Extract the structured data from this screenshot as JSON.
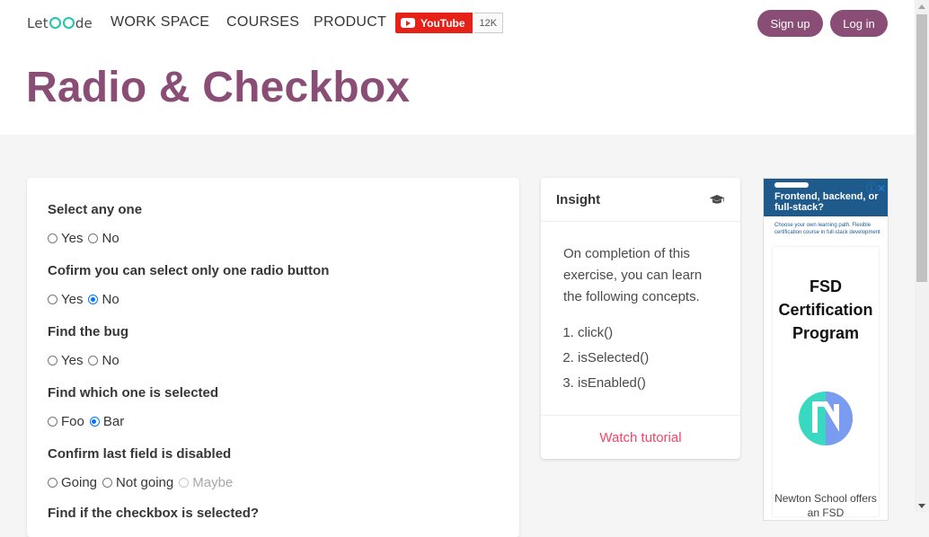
{
  "header": {
    "logo_text_prefix": "Let",
    "logo_text_suffix": "de",
    "nav": [
      "WORK SPACE",
      "COURSES",
      "PRODUCT"
    ],
    "youtube_label": "YouTube",
    "youtube_count": "12K",
    "signup_label": "Sign up",
    "login_label": "Log in"
  },
  "page_title": "Radio & Checkbox",
  "questions": [
    {
      "label": "Select any one",
      "options": [
        {
          "text": "Yes",
          "state": "unchecked"
        },
        {
          "text": "No",
          "state": "unchecked"
        }
      ]
    },
    {
      "label": "Cofirm you can select only one radio button",
      "options": [
        {
          "text": "Yes",
          "state": "unchecked"
        },
        {
          "text": "No",
          "state": "checked"
        }
      ]
    },
    {
      "label": "Find the bug",
      "options": [
        {
          "text": "Yes",
          "state": "unchecked"
        },
        {
          "text": "No",
          "state": "unchecked"
        }
      ]
    },
    {
      "label": "Find which one is selected",
      "options": [
        {
          "text": "Foo",
          "state": "unchecked"
        },
        {
          "text": "Bar",
          "state": "checked"
        }
      ]
    },
    {
      "label": "Confirm last field is disabled",
      "options": [
        {
          "text": "Going",
          "state": "unchecked"
        },
        {
          "text": "Not going",
          "state": "unchecked"
        },
        {
          "text": "Maybe",
          "state": "disabled"
        }
      ]
    },
    {
      "label": "Find if the checkbox is selected?",
      "options": []
    }
  ],
  "insight": {
    "title": "Insight",
    "description": "On completion of this exercise, you can learn the following concepts.",
    "items": [
      "click()",
      "isSelected()",
      "isEnabled()"
    ],
    "footer_link": "Watch tutorial"
  },
  "ad": {
    "headline": "Frontend, backend, or full-stack?",
    "subtext": "Choose your own learning path. Flexible certification course in full-stack development",
    "card_title": "FSD Certification Program",
    "footer": "Newton School offers an FSD"
  },
  "colors": {
    "brand": "#8a4d76",
    "link": "#f14668",
    "radio_checked": "#0075ff"
  }
}
